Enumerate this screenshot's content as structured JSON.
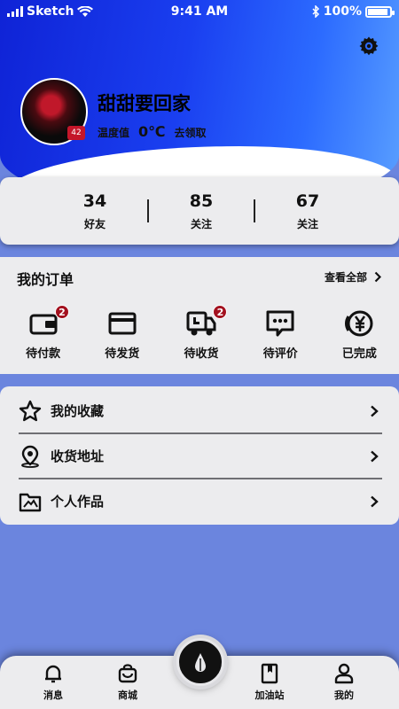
{
  "status_bar": {
    "carrier": "Sketch",
    "time": "9:41 AM",
    "battery": "100%"
  },
  "profile": {
    "username": "甜甜要回家",
    "avatar_badge": "42",
    "temperature_label": "温度值",
    "temperature_value": "0℃",
    "temperature_hint": "去领取"
  },
  "stats": [
    {
      "value": "34",
      "label": "好友"
    },
    {
      "value": "85",
      "label": "关注"
    },
    {
      "value": "67",
      "label": "关注"
    }
  ],
  "orders": {
    "title": "我的订单",
    "view_all": "查看全部",
    "items": [
      {
        "label": "待付款",
        "icon": "wallet-icon",
        "badge": "2"
      },
      {
        "label": "待发货",
        "icon": "box-icon"
      },
      {
        "label": "待收货",
        "icon": "truck-icon",
        "badge": "2"
      },
      {
        "label": "待评价",
        "icon": "comment-icon"
      },
      {
        "label": "已完成",
        "icon": "yen-icon"
      }
    ]
  },
  "menu": [
    {
      "label": "我的收藏",
      "icon": "star-icon"
    },
    {
      "label": "收货地址",
      "icon": "location-pin-icon"
    },
    {
      "label": "个人作品",
      "icon": "folder-image-icon"
    }
  ],
  "tabbar": [
    {
      "label": "消息",
      "icon": "bell-icon"
    },
    {
      "label": "商城",
      "icon": "shop-bag-icon"
    },
    {
      "label": "加油站",
      "icon": "bookmark-book-icon"
    },
    {
      "label": "我的",
      "icon": "user-icon"
    }
  ],
  "colors": {
    "hero_blue": "#1a3ff0",
    "background": "#6b85de",
    "card": "#ececee",
    "badge_red": "#a3111f"
  }
}
